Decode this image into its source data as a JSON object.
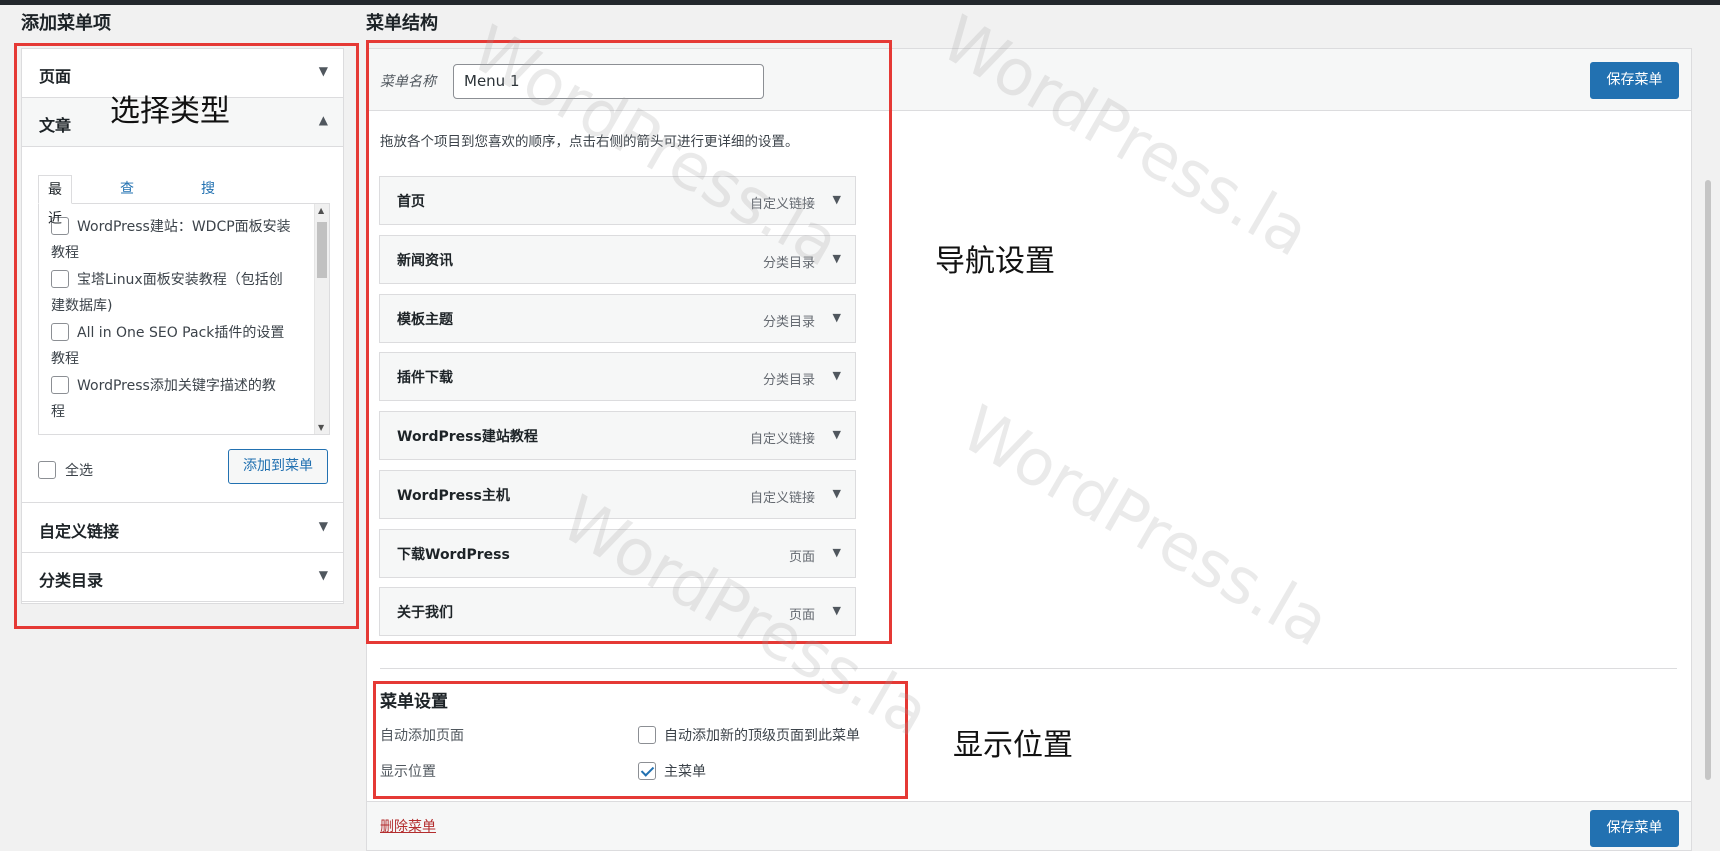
{
  "left": {
    "heading": "添加菜单项",
    "sections": [
      {
        "label": "页面",
        "arrow": "▼"
      },
      {
        "label": "文章",
        "arrow": "▲"
      },
      {
        "label": "自定义链接",
        "arrow": "▼"
      },
      {
        "label": "分类目录",
        "arrow": "▼"
      }
    ],
    "tabs": [
      "最近",
      "查看所有",
      "搜索"
    ],
    "posts": [
      {
        "line1": "WordPress建站：WDCP面板安装",
        "line2": "教程"
      },
      {
        "line1": "宝塔Linux面板安装教程（包括创",
        "line2": "建数据库)"
      },
      {
        "line1": "All in One SEO Pack插件的设置",
        "line2": "教程"
      },
      {
        "line1": "WordPress添加关键字描述的教",
        "line2": "程"
      }
    ],
    "select_all": "全选",
    "add_button": "添加到菜单"
  },
  "right": {
    "heading": "菜单结构",
    "menu_name_label": "菜单名称",
    "menu_name_value": "Menu 1",
    "save_label": "保存菜单",
    "instructions": "拖放各个项目到您喜欢的顺序，点击右侧的箭头可进行更详细的设置。",
    "items": [
      {
        "title": "首页",
        "type": "自定义链接"
      },
      {
        "title": "新闻资讯",
        "type": "分类目录"
      },
      {
        "title": "模板主题",
        "type": "分类目录"
      },
      {
        "title": "插件下载",
        "type": "分类目录"
      },
      {
        "title": "WordPress建站教程",
        "type": "自定义链接"
      },
      {
        "title": "WordPress主机",
        "type": "自定义链接"
      },
      {
        "title": "下载WordPress",
        "type": "页面"
      },
      {
        "title": "关于我们",
        "type": "页面"
      }
    ],
    "settings": {
      "title": "菜单设置",
      "auto_add_label": "自动添加页面",
      "auto_add_option": "自动添加新的顶级页面到此菜单",
      "auto_add_checked": false,
      "location_label": "显示位置",
      "location_option": "主菜单",
      "location_checked": true
    },
    "delete_label": "删除菜单"
  },
  "annotations": {
    "select_type": "选择类型",
    "nav_settings": "导航设置",
    "display_location": "显示位置"
  },
  "watermark": "WordPress.la",
  "colors": {
    "accent": "#2271b1",
    "annotation_red": "#e53935",
    "delete_red": "#b32d2e"
  }
}
